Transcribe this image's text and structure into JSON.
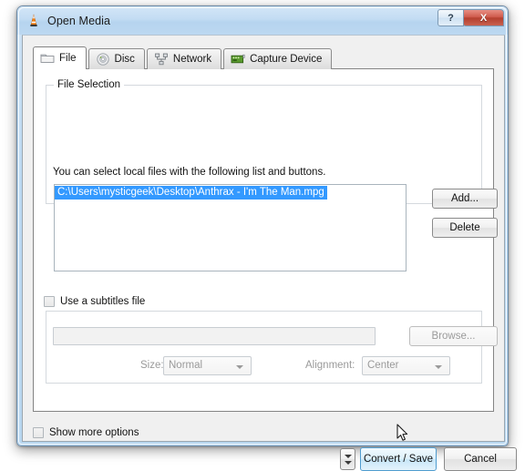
{
  "window": {
    "title": "Open Media",
    "app_icon": "vlc-cone-icon",
    "help_label": "?",
    "close_label": "X",
    "accent_color": "#3399ff",
    "titlebar_color": "#bcd8f1",
    "close_button_color": "#b4402f"
  },
  "tabs": [
    {
      "label": "File",
      "icon": "folder-icon",
      "active": true
    },
    {
      "label": "Disc",
      "icon": "disc-icon",
      "active": false
    },
    {
      "label": "Network",
      "icon": "network-icon",
      "active": false
    },
    {
      "label": "Capture Device",
      "icon": "capture-card-icon",
      "active": false
    }
  ],
  "file_selection": {
    "group_title": "File Selection",
    "hint": "You can select local files with the following list and buttons.",
    "files": [
      {
        "path": "C:\\Users\\mysticgeek\\Desktop\\Anthrax - I'm The Man.mpg",
        "selected": true
      }
    ],
    "add_label": "Add...",
    "delete_label": "Delete"
  },
  "subtitles": {
    "checkbox_label": "Use a subtitles file",
    "checked": false,
    "path_value": "",
    "path_placeholder": "",
    "browse_label": "Browse...",
    "size_label": "Size:",
    "size_value": "Normal",
    "alignment_label": "Alignment:",
    "alignment_value": "Center",
    "enabled": false
  },
  "footer": {
    "show_more_label": "Show more options",
    "show_more_checked": false,
    "convert_save_label": "Convert / Save",
    "cancel_label": "Cancel",
    "dropdown_icon": "chevron-down-icon"
  }
}
